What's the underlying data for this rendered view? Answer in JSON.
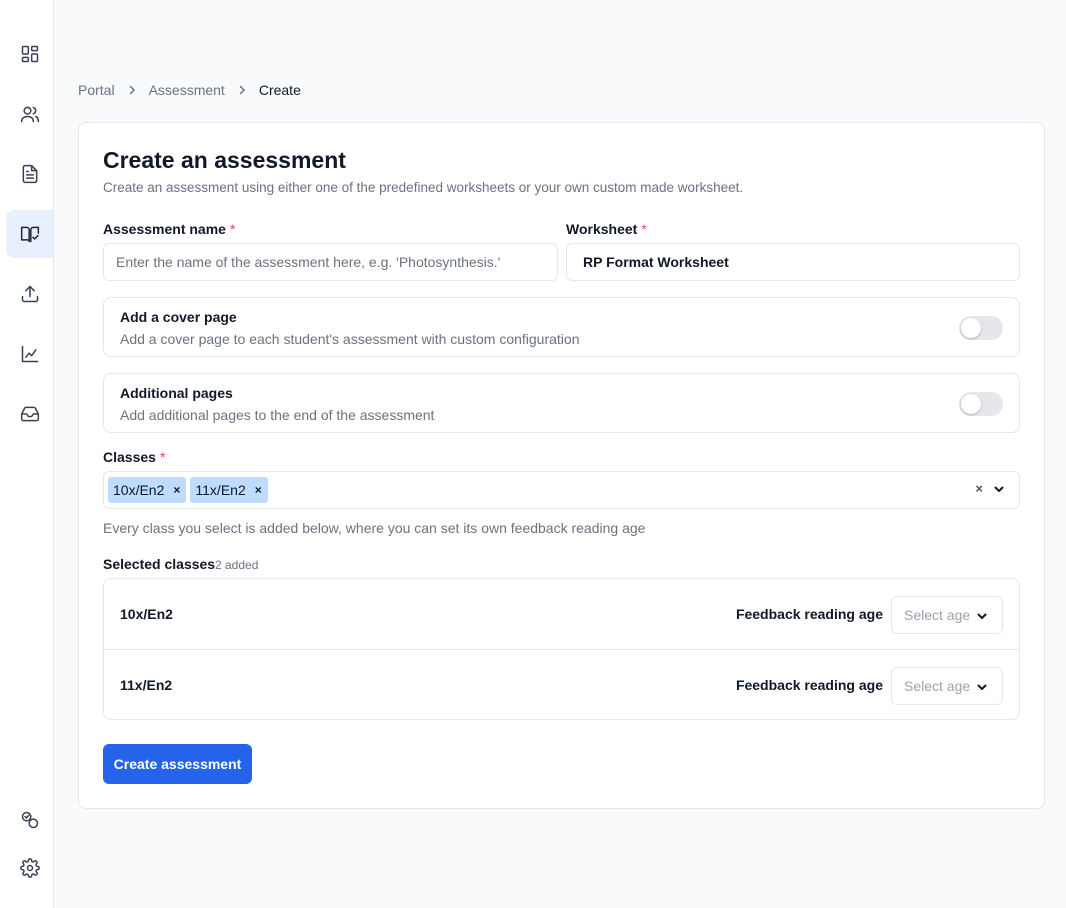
{
  "sidebar": {
    "items": [
      {
        "icon": "dashboard-icon",
        "active": false
      },
      {
        "icon": "users-icon",
        "active": false
      },
      {
        "icon": "document-icon",
        "active": false
      },
      {
        "icon": "book-check-icon",
        "active": true
      },
      {
        "icon": "upload-icon",
        "active": false
      },
      {
        "icon": "chart-line-icon",
        "active": false
      },
      {
        "icon": "inbox-icon",
        "active": false
      }
    ],
    "bottom_items": [
      {
        "icon": "toggle-circles-icon"
      },
      {
        "icon": "gear-icon"
      }
    ]
  },
  "breadcrumb": {
    "items": [
      "Portal",
      "Assessment",
      "Create"
    ]
  },
  "form": {
    "title": "Create an assessment",
    "subtitle": "Create an assessment using either one of the predefined worksheets or your own custom made worksheet.",
    "assessment_name": {
      "label": "Assessment name",
      "required_mark": "*",
      "placeholder": "Enter the name of the assessment here, e.g. 'Photosynthesis.'",
      "value": ""
    },
    "worksheet": {
      "label": "Worksheet",
      "required_mark": "*",
      "value": "RP Format Worksheet"
    },
    "cover_page": {
      "title": "Add a cover page",
      "description": "Add a cover page to each student's assessment with custom configuration",
      "enabled": false
    },
    "additional_pages": {
      "title": "Additional pages",
      "description": "Add additional pages to the end of the assessment",
      "enabled": false
    },
    "classes": {
      "label": "Classes",
      "required_mark": "*",
      "chips": [
        "10x/En2",
        "11x/En2"
      ],
      "chip_remove": "×",
      "clear": "×",
      "hint": "Every class you select is added below, where you can set its own feedback reading age"
    },
    "selected_classes": {
      "label": "Selected classes",
      "count": "2 added",
      "rows": [
        {
          "name": "10x/En2",
          "feedback_label": "Feedback reading age",
          "age_placeholder": "Select age"
        },
        {
          "name": "11x/En2",
          "feedback_label": "Feedback reading age",
          "age_placeholder": "Select age"
        }
      ]
    },
    "submit_label": "Create assessment"
  },
  "colors": {
    "primary": "#2563eb",
    "chip": "#bfdbfe",
    "active_nav": "#e8f0fe",
    "required": "#ef4444"
  }
}
